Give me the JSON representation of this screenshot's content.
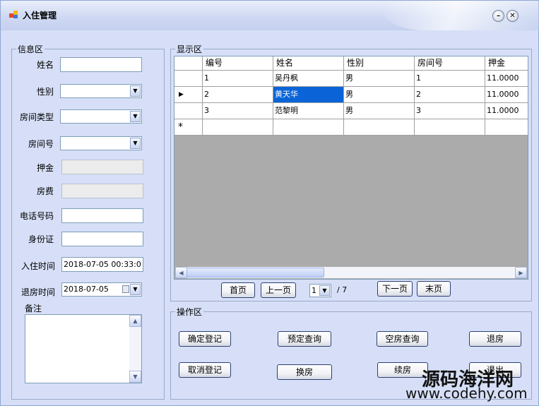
{
  "window": {
    "title": "入住管理"
  },
  "info": {
    "legend": "信息区",
    "name_label": "姓名",
    "name_value": "",
    "gender_label": "性别",
    "gender_value": "",
    "roomtype_label": "房间类型",
    "roomtype_value": "",
    "roomno_label": "房间号",
    "roomno_value": "",
    "deposit_label": "押金",
    "deposit_value": "",
    "fee_label": "房费",
    "fee_value": "",
    "phone_label": "电话号码",
    "phone_value": "",
    "id_label": "身份证",
    "id_value": "",
    "checkin_label": "入住时间",
    "checkin_value": "2018-07-05 00:33:0",
    "checkout_label": "退房时间",
    "checkout_value": "2018-07-05",
    "remark_label": "备注"
  },
  "display": {
    "legend": "显示区",
    "columns": [
      "编号",
      "姓名",
      "性别",
      "房间号",
      "押金"
    ],
    "rows": [
      [
        "1",
        "吴丹枫",
        "男",
        "1",
        "11.0000"
      ],
      [
        "2",
        "黄天华",
        "男",
        "2",
        "11.0000"
      ],
      [
        "3",
        "范黎明",
        "男",
        "3",
        "11.0000"
      ]
    ],
    "new_row_marker": "*",
    "current_row_marker": "▶"
  },
  "pager": {
    "first": "首页",
    "prev": "上一页",
    "page": "1",
    "total": "/ 7",
    "next": "下一页",
    "last": "末页"
  },
  "ops": {
    "legend": "操作区",
    "confirm": "确定登记",
    "reserve_query": "预定查询",
    "vacant_query": "空房查询",
    "checkout": "退房",
    "cancel": "取消登记",
    "change_room": "换房",
    "renew": "续房",
    "exit": "退出"
  },
  "watermark": {
    "line1": "源码海洋网",
    "line2": "www.codehy.com"
  },
  "colors": {
    "selection": "#0a64d8",
    "window_bg": "#d6dff7",
    "grid_empty": "#ababab"
  }
}
